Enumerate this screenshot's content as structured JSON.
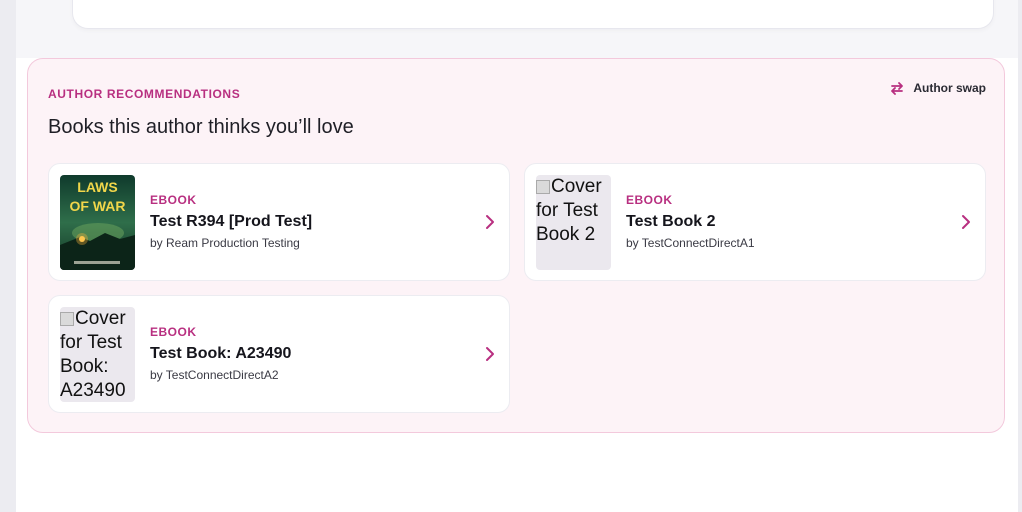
{
  "section": {
    "eyebrow": "AUTHOR RECOMMENDATIONS",
    "heading": "Books this author thinks you’ll love",
    "swap_label": "Author swap",
    "accent_color": "#b82f80",
    "background_color": "#fdf3f7"
  },
  "books": [
    {
      "format": "EBOOK",
      "title": "Test R394 [Prod Test]",
      "byline": "by Ream Production Testing",
      "cover_text": "LAWS OF WAR",
      "cover_has_image": true
    },
    {
      "format": "EBOOK",
      "title": "Test Book 2",
      "byline": "by TestConnectDirectA1",
      "cover_alt": "Cover for Test Book 2",
      "cover_has_image": false
    },
    {
      "format": "EBOOK",
      "title": "Test Book: A23490",
      "byline": "by TestConnectDirectA2",
      "cover_alt": "Cover for Test Book: A23490",
      "cover_has_image": false
    }
  ],
  "icons": {
    "swap": "swap-arrows-icon",
    "chevron": "chevron-right-icon",
    "broken_image": "broken-image-icon"
  }
}
